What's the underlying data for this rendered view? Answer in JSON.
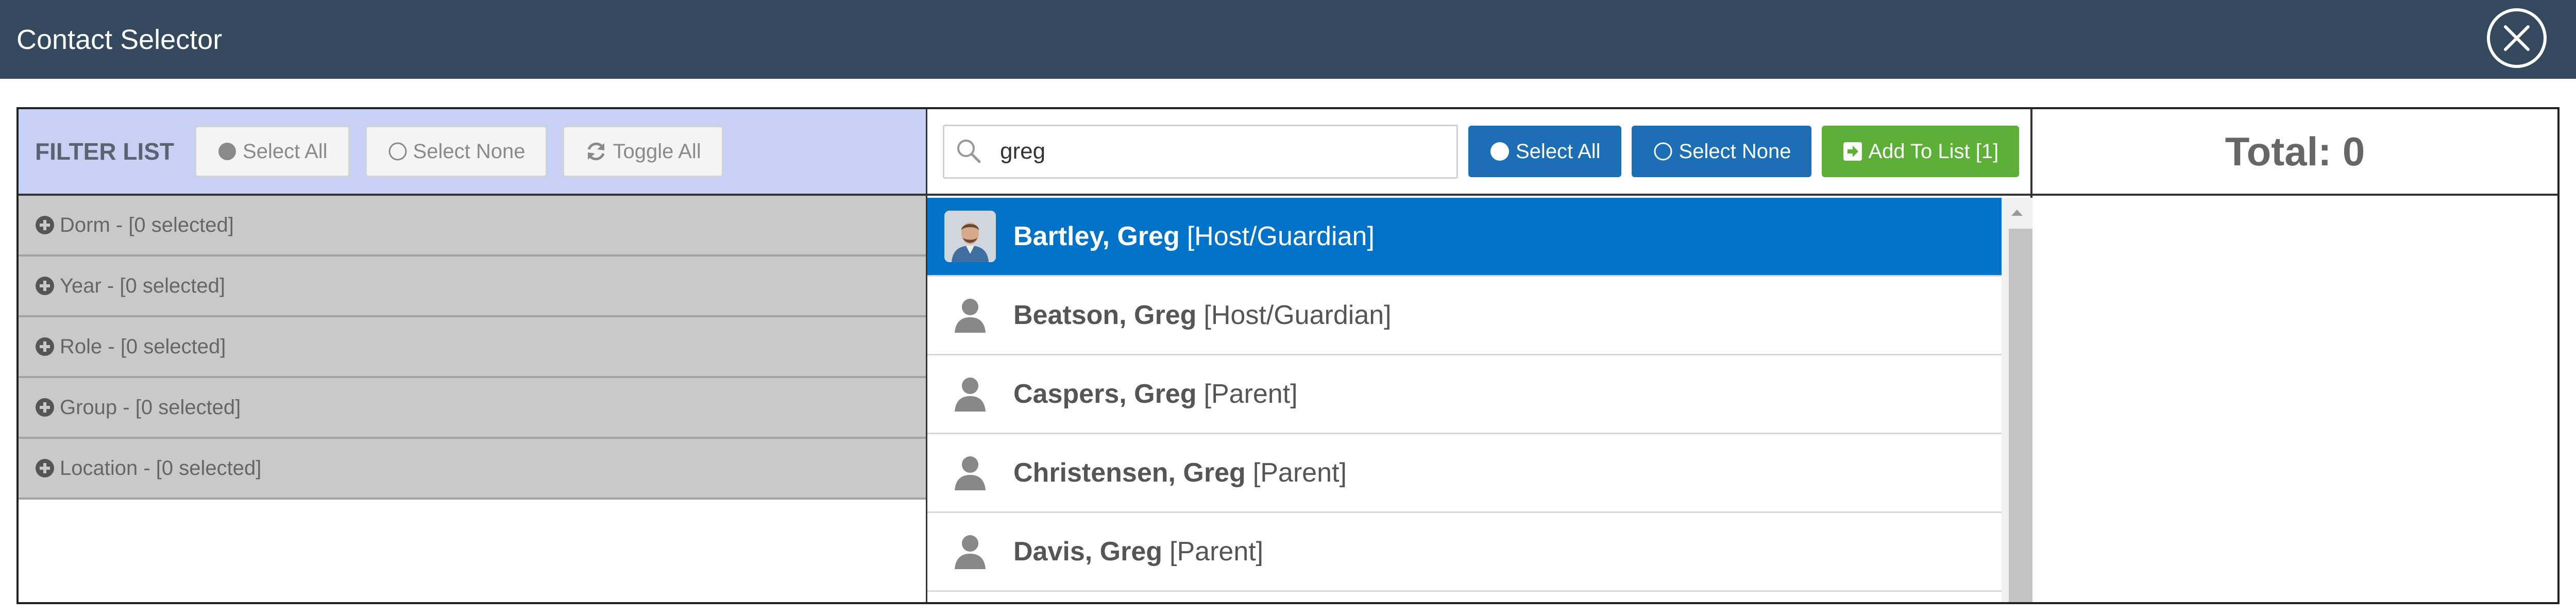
{
  "window": {
    "title": "Contact Selector"
  },
  "filter": {
    "title": "FILTER LIST",
    "select_all": "Select All",
    "select_none": "Select None",
    "toggle_all": "Toggle All",
    "rows": [
      "Dorm - [0 selected]",
      "Year - [0 selected]",
      "Role - [0 selected]",
      "Group - [0 selected]",
      "Location - [0 selected]"
    ]
  },
  "search": {
    "value": "greg",
    "select_all": "Select All",
    "select_none": "Select None",
    "add_to_list": "Add To List [1]"
  },
  "results": [
    {
      "name": "Bartley, Greg",
      "role": "[Host/Guardian]",
      "selected": true,
      "avatar": "photo"
    },
    {
      "name": "Beatson, Greg",
      "role": "[Host/Guardian]",
      "selected": false,
      "avatar": "person-icon"
    },
    {
      "name": "Caspers, Greg",
      "role": "[Parent]",
      "selected": false,
      "avatar": "person-icon"
    },
    {
      "name": "Christensen, Greg",
      "role": "[Parent]",
      "selected": false,
      "avatar": "person-icon"
    },
    {
      "name": "Davis, Greg",
      "role": "[Parent]",
      "selected": false,
      "avatar": "person-icon"
    }
  ],
  "total": {
    "label": "Total: 0"
  },
  "colors": {
    "titlebar": "#34495e",
    "filter_header": "#c6d1f3",
    "selected_row": "#0073c8",
    "button_blue": "#1c6eb5",
    "button_green": "#5cb038"
  }
}
